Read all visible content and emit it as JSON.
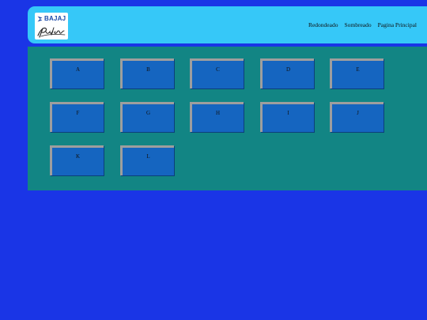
{
  "brand": {
    "name": "BAJAJ",
    "model": "Pulsar"
  },
  "nav": {
    "items": [
      {
        "label": "Redondeado"
      },
      {
        "label": "Sombreado"
      },
      {
        "label": "Pagina Principal"
      }
    ]
  },
  "grid": {
    "tiles": [
      "A",
      "B",
      "C",
      "D",
      "E",
      "F",
      "G",
      "H",
      "I",
      "J",
      "K",
      "L"
    ]
  },
  "colors": {
    "page_background": "#1a35e6",
    "header_background": "#36c8f8",
    "panel_background": "#128584",
    "tile_background": "#1565c0",
    "tile_bevel": "#9e9e9e",
    "brand_blue": "#1c4aa8"
  }
}
